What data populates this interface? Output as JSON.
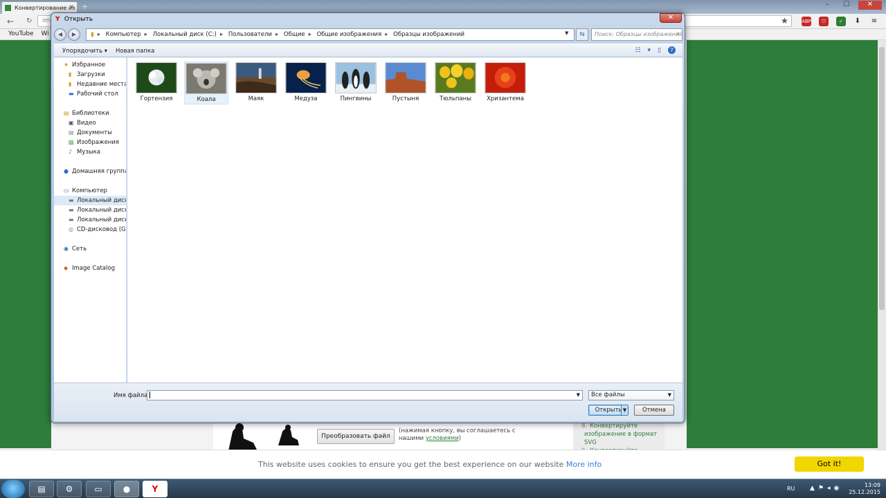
{
  "browser": {
    "tab_title": "Конвертирование из",
    "omnibox_text": "ima",
    "bookmarks": [
      "YouTube",
      "Wi"
    ]
  },
  "page": {
    "convert_button": "Преобразовать файл",
    "convert_note_pre": "(нажимая кнопку, вы соглашаетесь с нашими",
    "convert_note_link": "условиями",
    "convert_note_post": ")",
    "side_list": [
      {
        "num": "8.",
        "text": "Конвертируйте"
      },
      {
        "num": "",
        "text": "изображение в формат"
      },
      {
        "num": "",
        "text": "SVG"
      },
      {
        "num": "9.",
        "text": "Конвертируйте"
      }
    ]
  },
  "cookie": {
    "text": "This website uses cookies to ensure you get the best experience on our website",
    "link": "More info",
    "button": "Got it!"
  },
  "dialog": {
    "title": "Открыть",
    "path": [
      "Компьютер",
      "Локальный диск (C:)",
      "Пользователи",
      "Общие",
      "Общие изображения",
      "Образцы изображений"
    ],
    "search_placeholder": "Поиск: Образцы изображений",
    "organize": "Упорядочить",
    "new_folder": "Новая папка",
    "nav": {
      "favorites": {
        "label": "Избранное",
        "items": [
          "Загрузки",
          "Недавние места",
          "Рабочий стол"
        ]
      },
      "libraries": {
        "label": "Библиотеки",
        "items": [
          "Видео",
          "Документы",
          "Изображения",
          "Музыка"
        ]
      },
      "homegroup": "Домашняя группа",
      "computer": {
        "label": "Компьютер",
        "items": [
          "Локальный диск (C",
          "Локальный диск (D",
          "Локальный диск (F:",
          "CD-дисковод (G:)"
        ]
      },
      "network": "Сеть",
      "image_catalog": "Image Catalog"
    },
    "files": [
      "Гортензия",
      "Коала",
      "Маяк",
      "Медуза",
      "Пингвины",
      "Пустыня",
      "Тюльпаны",
      "Хризантема"
    ],
    "filename_label": "Имя файла:",
    "filename_value": "",
    "filetype": "Все файлы",
    "open_button": "Открыть",
    "cancel_button": "Отмена"
  },
  "taskbar": {
    "lang": "RU",
    "time": "13:09",
    "date": "25.12.2015"
  },
  "colors": {
    "accent_green": "#2e7d3b",
    "cookie_button": "#f1d600",
    "link_blue": "#3a7bd5"
  }
}
